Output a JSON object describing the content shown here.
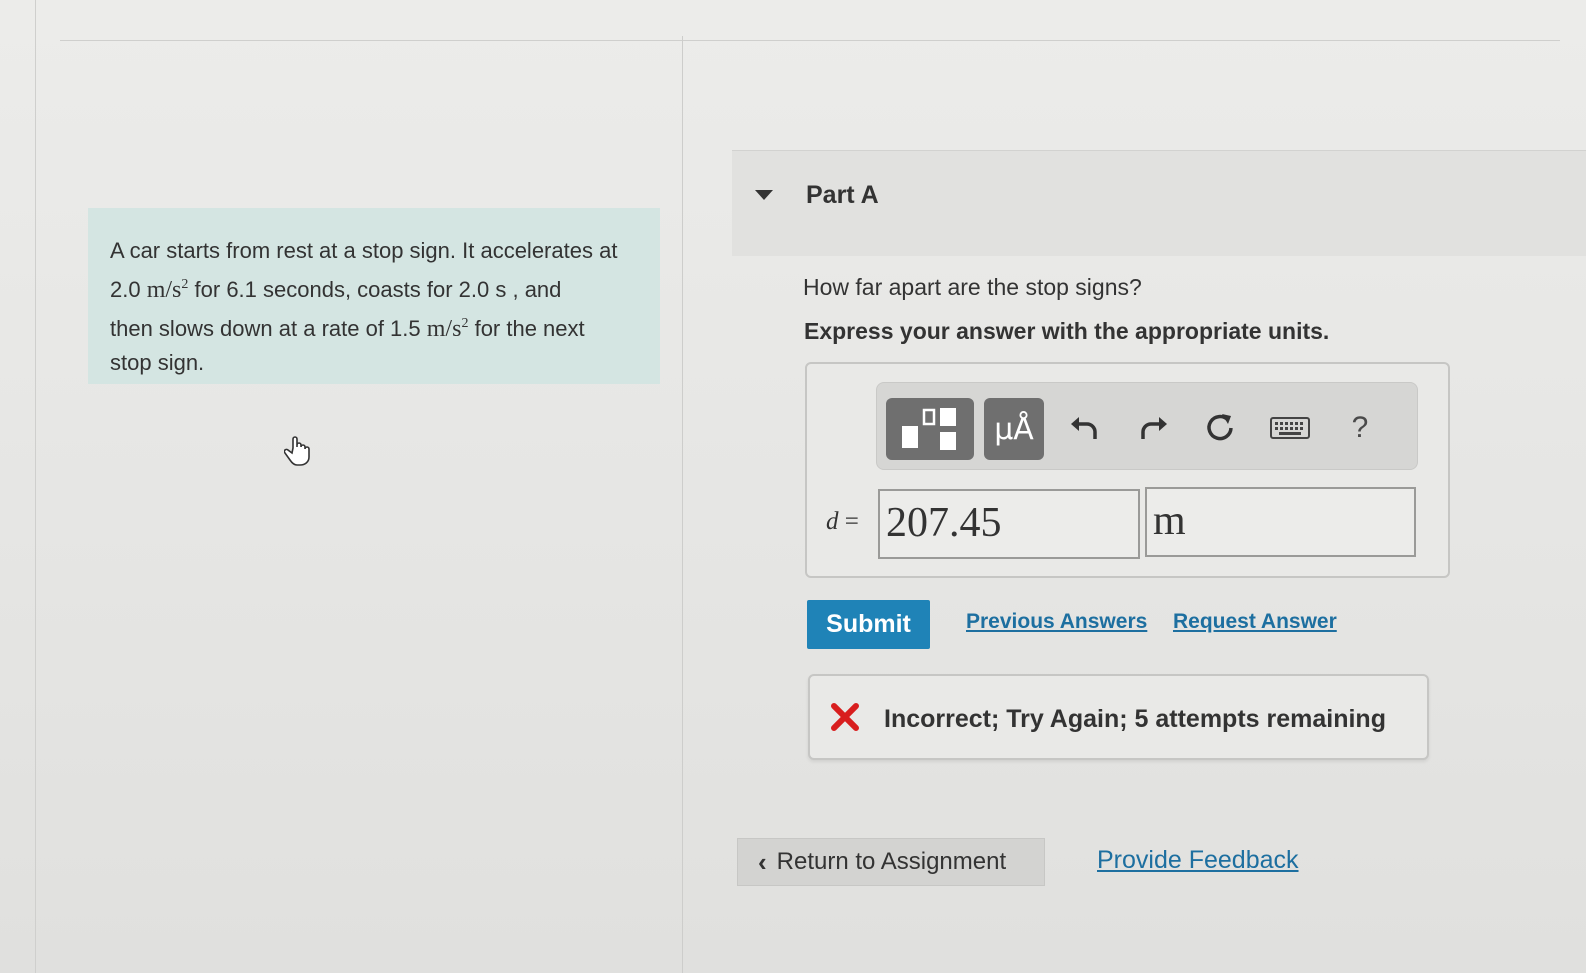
{
  "problem": {
    "text_1": "A car starts from rest at a stop sign. It accelerates at",
    "accel_1_value": "2.0",
    "accel_unit": "m/s",
    "accel_exp": "2",
    "text_2": "for 6.1 seconds, coasts for 2.0  s , and",
    "text_3": "then slows down at a rate of 1.5",
    "text_4": "for the next",
    "text_5": "stop sign."
  },
  "part": {
    "title": "Part A",
    "question": "How far apart are the stop signs?",
    "instruction": "Express your answer with the appropriate units."
  },
  "toolbar": {
    "symbols_label": "μÅ",
    "help_label": "?"
  },
  "answer": {
    "variable": "d",
    "equals": "=",
    "value": "207.45",
    "unit": "m"
  },
  "actions": {
    "submit_label": "Submit",
    "previous_answers_label": "Previous Answers",
    "request_answer_label": "Request Answer"
  },
  "feedback": {
    "message": "Incorrect; Try Again; 5 attempts remaining"
  },
  "footer": {
    "return_label": "Return to Assignment",
    "provide_feedback_label": "Provide Feedback"
  },
  "colors": {
    "problem_bg": "#d4e5e2",
    "submit_bg": "#1f83b7",
    "link": "#1d6fa0",
    "error_red": "#d81e1e"
  },
  "icons": [
    "templates-icon",
    "undo-icon",
    "redo-icon",
    "reset-icon",
    "keyboard-icon",
    "help-icon",
    "error-x-icon",
    "chevron-left-icon",
    "hand-cursor-icon"
  ]
}
